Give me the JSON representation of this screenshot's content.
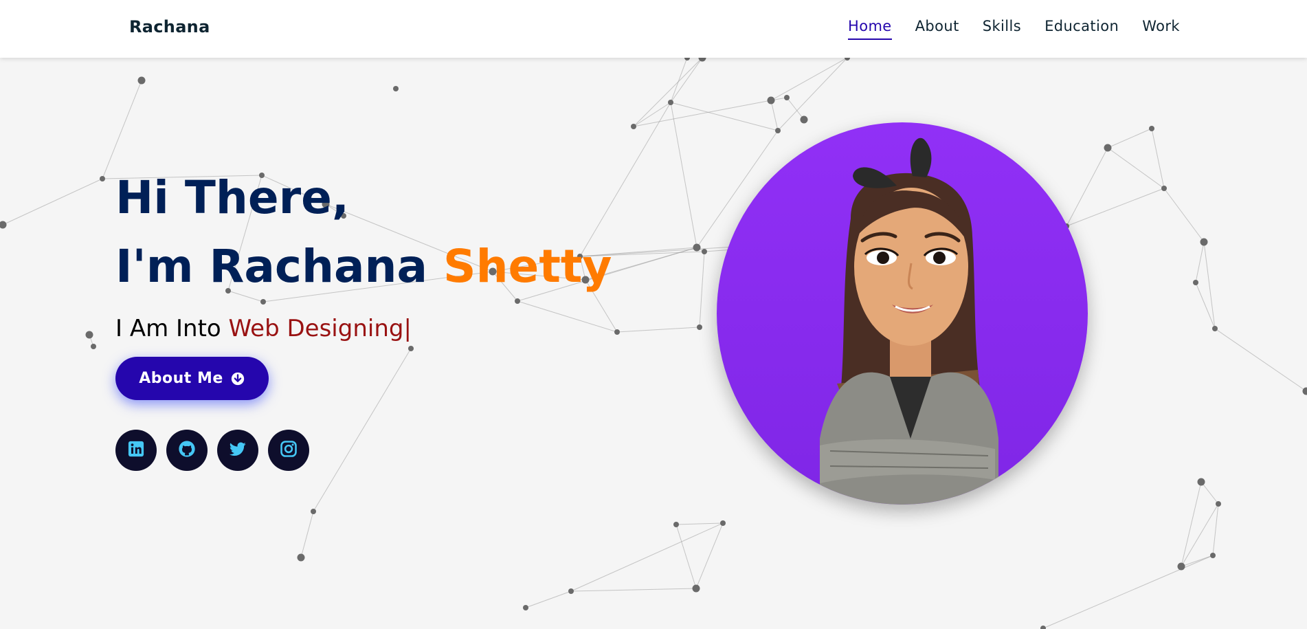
{
  "brand": {
    "name": "Rachana"
  },
  "nav": {
    "items": [
      {
        "label": "Home",
        "active": true
      },
      {
        "label": "About",
        "active": false
      },
      {
        "label": "Skills",
        "active": false
      },
      {
        "label": "Education",
        "active": false
      },
      {
        "label": "Work",
        "active": false
      }
    ]
  },
  "hero": {
    "greeting": "Hi There,",
    "intro": "I'm Rachana",
    "surname": "Shetty",
    "typing_prefix": "I Am Into",
    "typing_text": "Web Designing",
    "cursor": "|",
    "button_label": "About Me",
    "button_icon": "arrow-circle-down-icon"
  },
  "socials": [
    {
      "name": "linkedin",
      "icon": "linkedin-icon"
    },
    {
      "name": "github",
      "icon": "github-icon"
    },
    {
      "name": "twitter",
      "icon": "twitter-icon"
    },
    {
      "name": "instagram",
      "icon": "instagram-icon"
    }
  ],
  "colors": {
    "primary": "#2506ad",
    "heading": "#002057",
    "accent_orange": "#ff7b00",
    "accent_red": "#991212",
    "social_bg": "#0e0e2c",
    "social_icon": "#45c7f5",
    "avatar_bg": "#8b2cf5"
  }
}
